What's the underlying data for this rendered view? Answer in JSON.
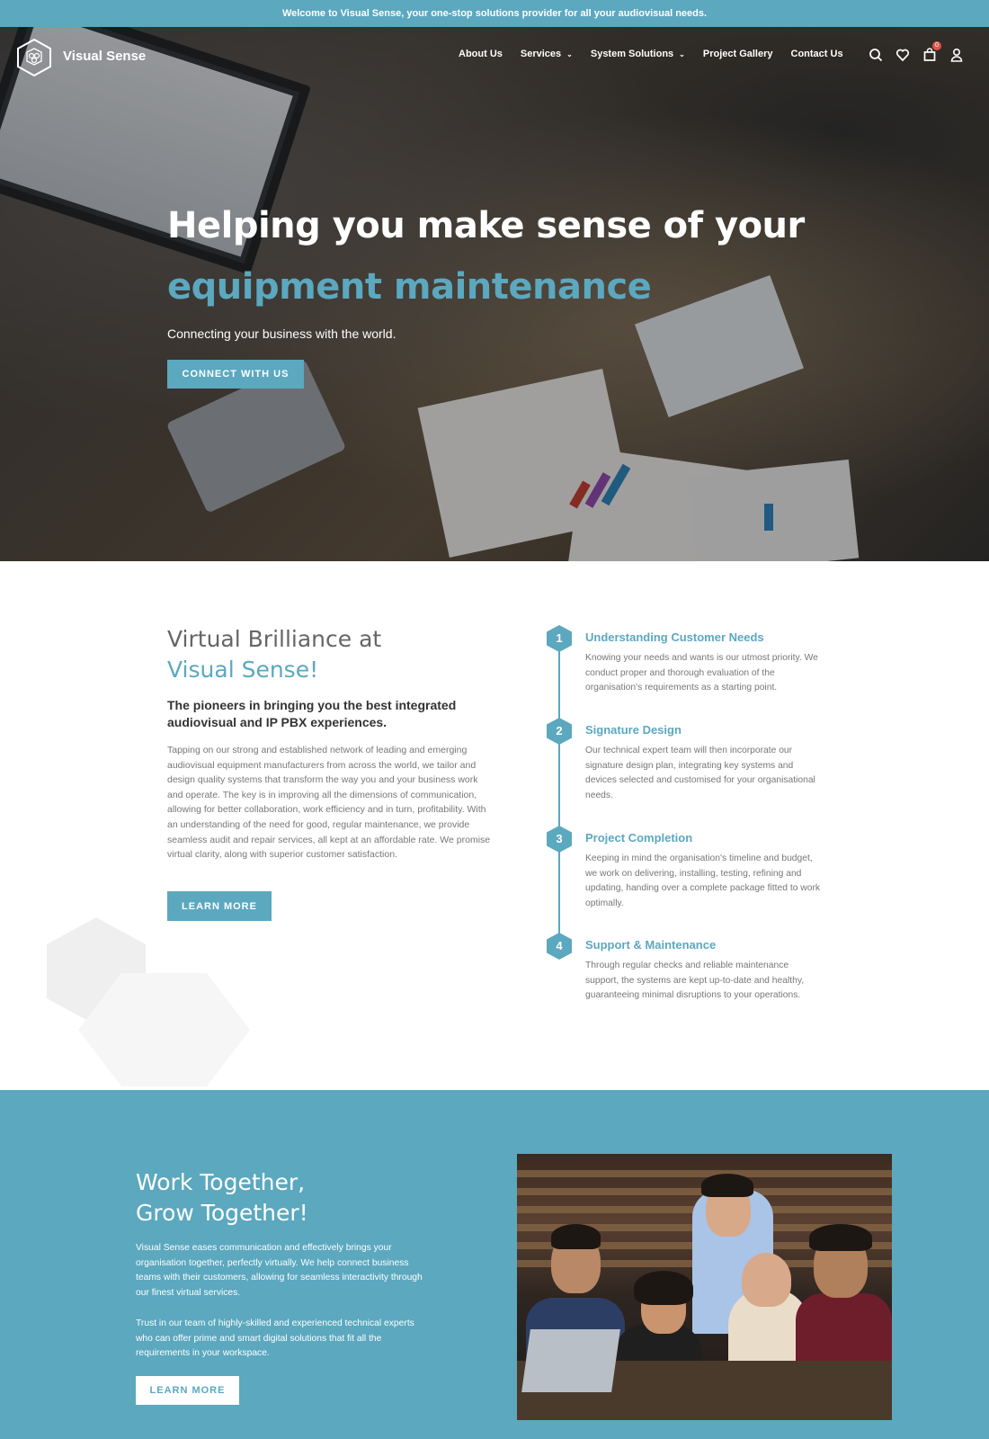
{
  "topbar": {
    "message": "Welcome to Visual Sense, your one-stop solutions provider for all your audiovisual needs."
  },
  "brand": {
    "name": "Visual Sense",
    "accent": "#5ba8bf"
  },
  "nav": {
    "items": [
      {
        "label": "About Us",
        "has_dropdown": false
      },
      {
        "label": "Services",
        "has_dropdown": true
      },
      {
        "label": "System Solutions",
        "has_dropdown": true
      },
      {
        "label": "Project Gallery",
        "has_dropdown": false
      },
      {
        "label": "Contact Us",
        "has_dropdown": false
      }
    ],
    "icons": [
      "search-icon",
      "heart-icon",
      "cart-icon",
      "user-icon"
    ],
    "cart_count": "0"
  },
  "hero": {
    "title_line1": "Helping you make sense of your",
    "title_line2": "equipment maintenance",
    "subtitle": "Connecting your business with the world.",
    "cta_label": "CONNECT WITH US"
  },
  "about": {
    "heading_line1": "Virtual Brilliance at",
    "heading_line2": "Visual Sense!",
    "lead": "The pioneers in bringing you the best integrated audiovisual and IP PBX experiences.",
    "body": "Tapping on our strong and established network of leading and emerging audiovisual equipment manufacturers from across the world, we tailor and design quality systems that transform the way you and your business work and operate. The key is in improving all the dimensions of communication, allowing for better collaboration, work efficiency and in turn, profitability. With an understanding of the need for good, regular maintenance, we provide seamless audit and repair services, all kept at an affordable rate. We promise virtual clarity, along with superior customer satisfaction.",
    "button_label": "LEARN MORE"
  },
  "steps": [
    {
      "number": "1",
      "title": "Understanding Customer Needs",
      "body": "Knowing your needs and wants is our utmost priority. We conduct proper and thorough evaluation of the organisation's requirements as a starting point."
    },
    {
      "number": "2",
      "title": "Signature Design",
      "body": "Our technical expert team will then incorporate our signature design plan, integrating key systems and devices selected and customised for your organisational needs."
    },
    {
      "number": "3",
      "title": "Project Completion",
      "body": "Keeping in mind the organisation's timeline and budget, we work on delivering, installing, testing, refining and updating, handing over a complete package fitted to work optimally."
    },
    {
      "number": "4",
      "title": "Support & Maintenance",
      "body": "Through regular checks and reliable maintenance support, the systems are kept up-to-date and healthy, guaranteeing minimal disruptions to your operations."
    }
  ],
  "together": {
    "heading_line1": "Work Together,",
    "heading_line2": "Grow Together!",
    "para1": "Visual Sense eases communication and effectively brings your organisation together, perfectly virtually. We help connect business teams with their customers, allowing for seamless interactivity through our finest virtual services.",
    "para2": "Trust in our team of highly-skilled and experienced technical experts who can offer prime and smart digital solutions that fit all the requirements in your workspace.",
    "button_label": "LEARN MORE"
  }
}
